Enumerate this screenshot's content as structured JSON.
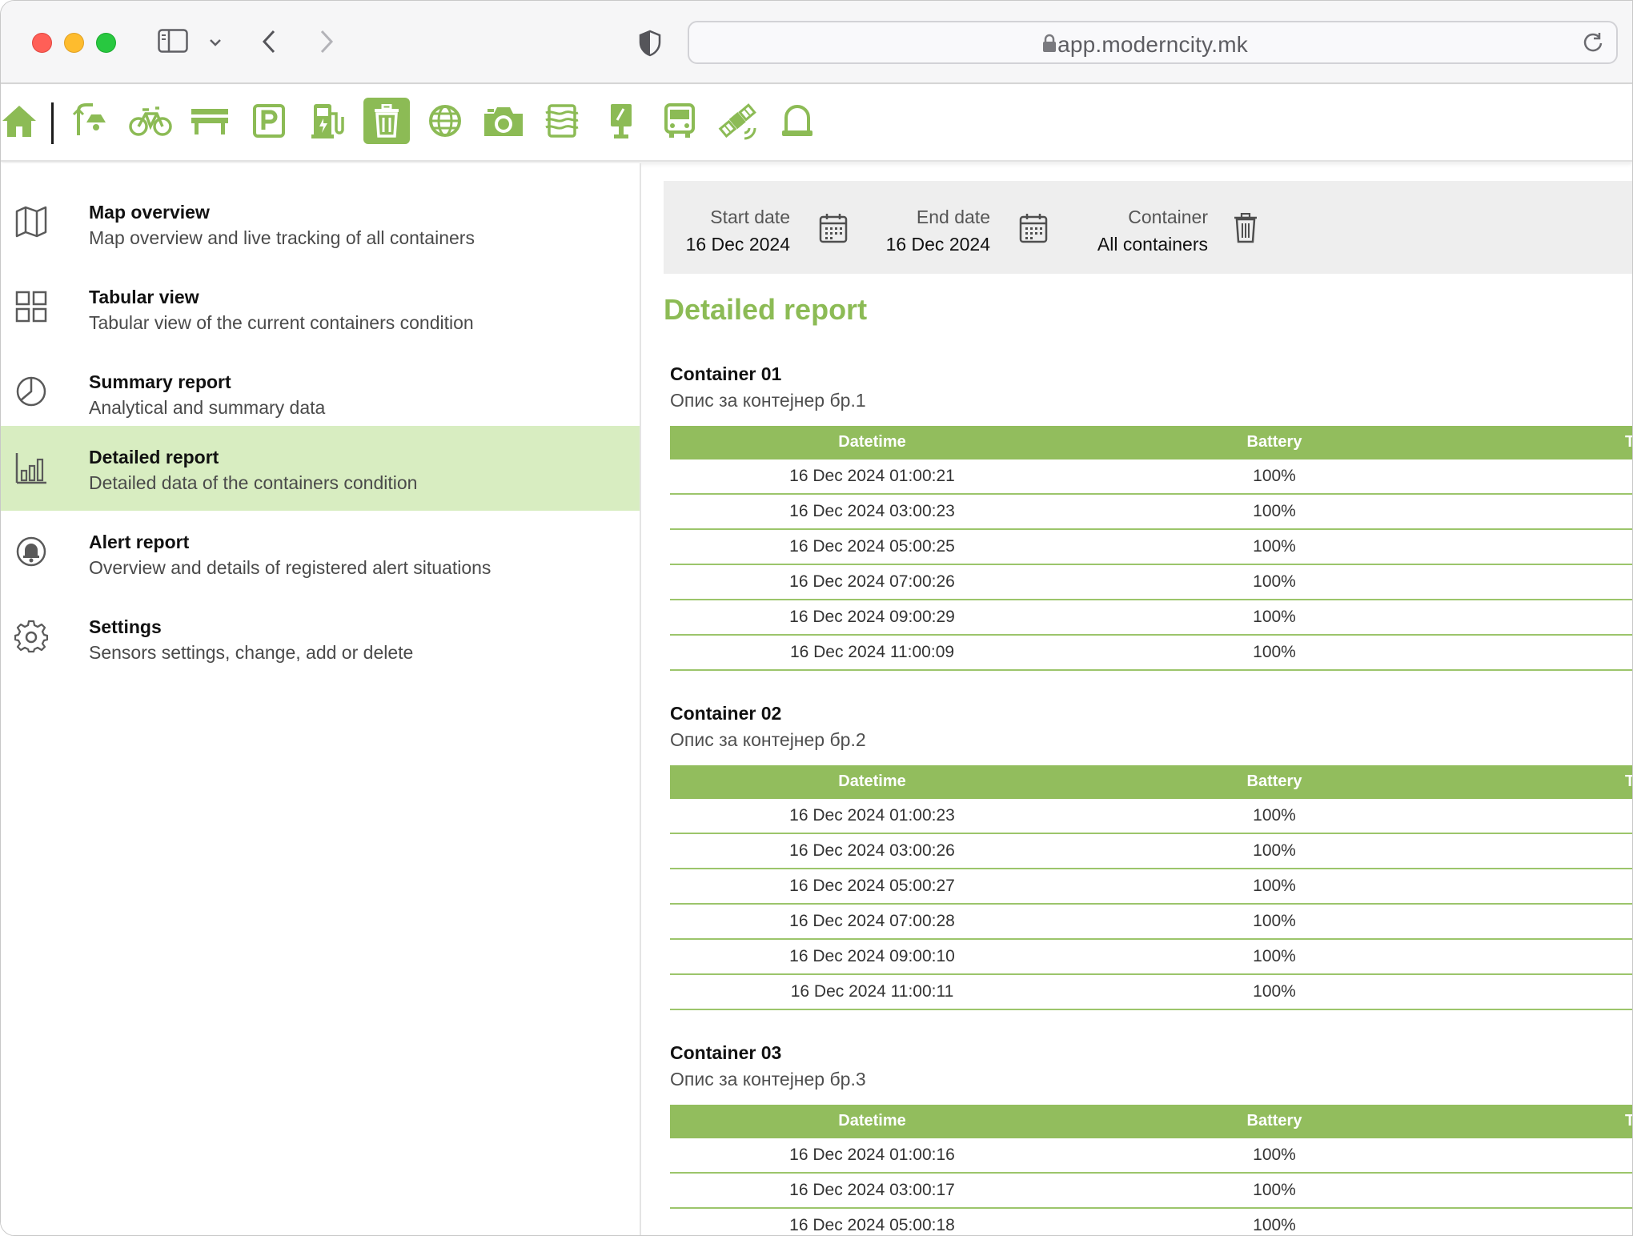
{
  "browser": {
    "url": "app.moderncity.mk"
  },
  "toolbar": {
    "icons": [
      {
        "name": "home-icon"
      },
      {
        "name": "street-lamp-icon"
      },
      {
        "name": "bicycle-icon"
      },
      {
        "name": "bench-icon"
      },
      {
        "name": "parking-icon"
      },
      {
        "name": "ev-charger-icon"
      },
      {
        "name": "trash-container-icon",
        "active": true
      },
      {
        "name": "globe-icon"
      },
      {
        "name": "camera-icon"
      },
      {
        "name": "air-quality-icon"
      },
      {
        "name": "info-board-icon"
      },
      {
        "name": "bus-icon"
      },
      {
        "name": "satellite-icon"
      },
      {
        "name": "alarm-icon"
      }
    ],
    "accent": "#8cbb55"
  },
  "sidebar": {
    "items": [
      {
        "title": "Map overview",
        "desc": "Map overview and live tracking of all containers",
        "icon": "map-icon"
      },
      {
        "title": "Tabular view",
        "desc": "Tabular view of the current containers condition",
        "icon": "grid-icon"
      },
      {
        "title": "Summary report",
        "desc": "Analytical and summary data",
        "icon": "pie-chart-icon"
      },
      {
        "title": "Detailed report",
        "desc": "Detailed data of the containers condition",
        "icon": "bar-chart-icon",
        "active": true
      },
      {
        "title": "Alert report",
        "desc": "Overview and details of registered alert situations",
        "icon": "bell-icon"
      },
      {
        "title": "Settings",
        "desc": "Sensors settings, change, add or delete",
        "icon": "gear-icon"
      }
    ]
  },
  "filters": {
    "start_label": "Start date",
    "start_value": "16 Dec 2024",
    "end_label": "End date",
    "end_value": "16 Dec 2024",
    "container_label": "Container",
    "container_value": "All containers"
  },
  "report": {
    "title": "Detailed report",
    "columns": [
      "Datetime",
      "Battery",
      "T"
    ],
    "containers": [
      {
        "title": "Container 01",
        "desc": "Опис за контејнер бр.1",
        "rows": [
          [
            "16 Dec 2024 01:00:21",
            "100%"
          ],
          [
            "16 Dec 2024 03:00:23",
            "100%"
          ],
          [
            "16 Dec 2024 05:00:25",
            "100%"
          ],
          [
            "16 Dec 2024 07:00:26",
            "100%"
          ],
          [
            "16 Dec 2024 09:00:29",
            "100%"
          ],
          [
            "16 Dec 2024 11:00:09",
            "100%"
          ]
        ]
      },
      {
        "title": "Container 02",
        "desc": "Опис за контејнер бр.2",
        "rows": [
          [
            "16 Dec 2024 01:00:23",
            "100%"
          ],
          [
            "16 Dec 2024 03:00:26",
            "100%"
          ],
          [
            "16 Dec 2024 05:00:27",
            "100%"
          ],
          [
            "16 Dec 2024 07:00:28",
            "100%"
          ],
          [
            "16 Dec 2024 09:00:10",
            "100%"
          ],
          [
            "16 Dec 2024 11:00:11",
            "100%"
          ]
        ]
      },
      {
        "title": "Container 03",
        "desc": "Опис за контејнер бр.3",
        "rows": [
          [
            "16 Dec 2024 01:00:16",
            "100%"
          ],
          [
            "16 Dec 2024 03:00:17",
            "100%"
          ],
          [
            "16 Dec 2024 05:00:18",
            "100%"
          ]
        ]
      }
    ]
  }
}
